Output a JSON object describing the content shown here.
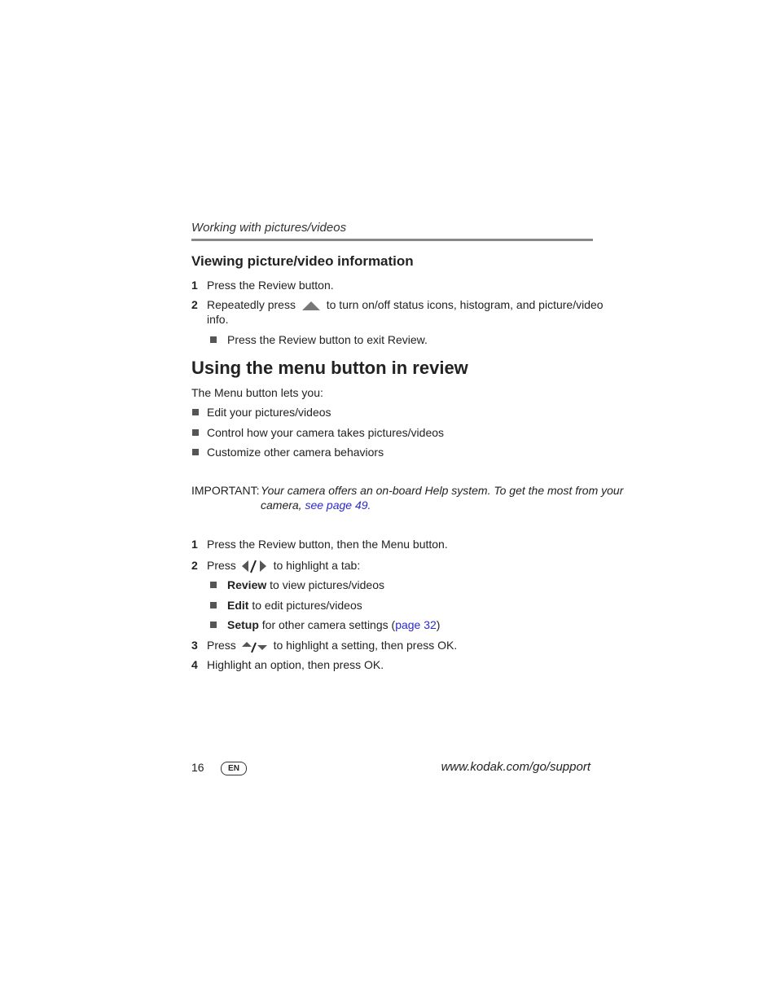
{
  "header": {
    "running_title": "Working with pictures/videos"
  },
  "section1": {
    "heading": "Viewing picture/video information",
    "step1_num": "1",
    "step1_text": "Press the Review button.",
    "step2_num": "2",
    "step2_pre": "Repeatedly press",
    "step2_post": "to turn on/off status icons, histogram, and picture/video",
    "step2_cont": "info.",
    "bullet1": "Press the Review button to exit Review."
  },
  "section2": {
    "heading": "Using the menu button in review",
    "intro": "The Menu button lets you:",
    "bullets": [
      "Edit your pictures/videos",
      "Control how your camera takes pictures/videos",
      "Customize other camera behaviors"
    ],
    "important_label": "IMPORTANT:",
    "important_line1": "Your camera offers an on-board Help system. To get the most from your",
    "important_line2_pre": "camera,",
    "important_link": "see page 49",
    "important_line2_post": ".",
    "step1_num": "1",
    "step1_text": "Press the Review button, then the Menu button.",
    "step2_num": "2",
    "step2_pre": "Press",
    "step2_post": "to highlight a tab:",
    "tabs": [
      {
        "name": "Review",
        "desc": "to view pictures/videos"
      },
      {
        "name": "Edit",
        "desc": "to edit pictures/videos"
      },
      {
        "name": "Setup",
        "desc": "for other camera settings (",
        "link": "page 32",
        "close": ")"
      }
    ],
    "step3_num": "3",
    "step3_pre": "Press",
    "step3_post": "to highlight a setting, then press OK.",
    "step4_num": "4",
    "step4_text": "Highlight an option, then press OK."
  },
  "footer": {
    "page_number": "16",
    "lang_badge": "EN",
    "url": "www.kodak.com/go/support"
  }
}
